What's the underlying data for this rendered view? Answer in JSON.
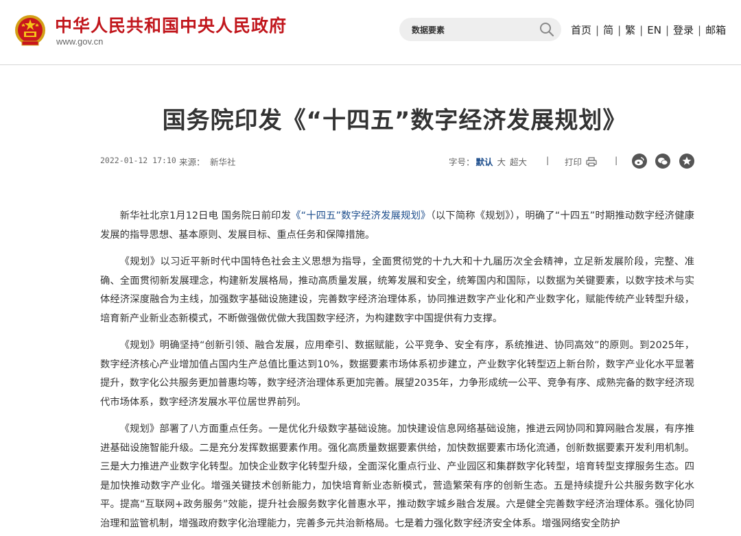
{
  "header": {
    "site_title": "中华人民共和国中央人民政府",
    "site_url": "www.gov.cn",
    "search_value": "数据要素",
    "nav": [
      "首页",
      "简",
      "繁",
      "EN",
      "登录",
      "邮箱"
    ],
    "brand_color": "#c1161c"
  },
  "article": {
    "title": "国务院印发《“十四五”数字经济发展规划》",
    "date": "2022-01-12 17:10",
    "source_label": "来源：",
    "source": "新华社",
    "fontsize_label": "字号：",
    "fontsize_current": "默认",
    "fontsize_large": "大",
    "fontsize_xlarge": "超大",
    "print_label": "打印",
    "share_icons": [
      "weibo-icon",
      "wechat-icon",
      "favorite-icon"
    ],
    "paragraphs": [
      {
        "pre": "新华社北京1月12日电 国务院日前印发",
        "link": "《“十四五”数字经济发展规划》",
        "post": "（以下简称《规划》），明确了“十四五”时期推动数字经济健康发展的指导思想、基本原则、发展目标、重点任务和保障措施。"
      },
      {
        "text": "《规划》以习近平新时代中国特色社会主义思想为指导，全面贯彻党的十九大和十九届历次全会精神，立足新发展阶段，完整、准确、全面贯彻新发展理念，构建新发展格局，推动高质量发展，统筹发展和安全，统筹国内和国际，以数据为关键要素，以数字技术与实体经济深度融合为主线，加强数字基础设施建设，完善数字经济治理体系，协同推进数字产业化和产业数字化，赋能传统产业转型升级，培育新产业新业态新模式，不断做强做优做大我国数字经济，为构建数字中国提供有力支撑。"
      },
      {
        "text": "《规划》明确坚持“创新引领、融合发展，应用牵引、数据赋能，公平竞争、安全有序，系统推进、协同高效”的原则。到2025年，数字经济核心产业增加值占国内生产总值比重达到10%，数据要素市场体系初步建立，产业数字化转型迈上新台阶，数字产业化水平显著提升，数字化公共服务更加普惠均等，数字经济治理体系更加完善。展望2035年，力争形成统一公平、竞争有序、成熟完备的数字经济现代市场体系，数字经济发展水平位居世界前列。"
      },
      {
        "text": "《规划》部署了八方面重点任务。一是优化升级数字基础设施。加快建设信息网络基础设施，推进云网协同和算网融合发展，有序推进基础设施智能升级。二是充分发挥数据要素作用。强化高质量数据要素供给，加快数据要素市场化流通，创新数据要素开发利用机制。三是大力推进产业数字化转型。加快企业数字化转型升级，全面深化重点行业、产业园区和集群数字化转型，培育转型支撑服务生态。四是加快推动数字产业化。增强关键技术创新能力，加快培育新业态新模式，营造繁荣有序的创新生态。五是持续提升公共服务数字化水平。提高“互联网+政务服务”效能，提升社会服务数字化普惠水平，推动数字城乡融合发展。六是健全完善数字经济治理体系。强化协同治理和监管机制，增强政府数字化治理能力，完善多元共治新格局。七是着力强化数字经济安全体系。增强网络安全防护"
      }
    ]
  }
}
